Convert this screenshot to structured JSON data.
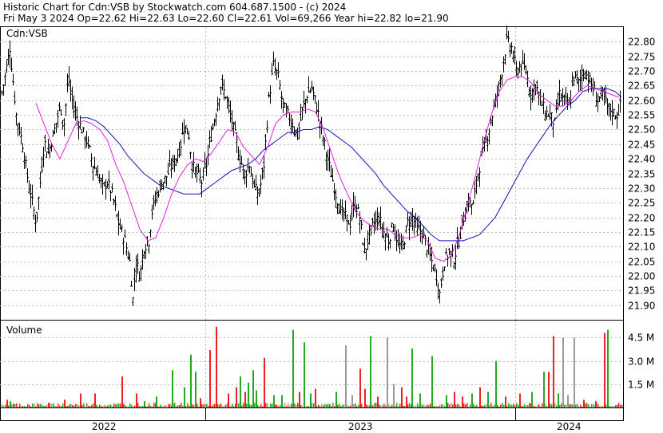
{
  "header": {
    "line1": "Historic Chart for Cdn:VSB by Stockwatch.com 604.687.1500 - (c) 2024",
    "line2": "Fri May  3 2024   Op=22.62   Hi=22.63   Lo=22.60   Cl=22.61   Vol=69,266   Year hi=22.82   lo=21.90"
  },
  "chart_data": [
    {
      "type": "ohlc",
      "title": "Cdn:VSB",
      "symbol_label": "Cdn:VSB",
      "ylim": [
        21.85,
        22.85
      ],
      "y_ticks": [
        "22.80",
        "22.75",
        "22.70",
        "22.65",
        "22.60",
        "22.55",
        "22.50",
        "22.45",
        "22.40",
        "22.35",
        "22.30",
        "22.25",
        "22.20",
        "22.15",
        "22.10",
        "22.05",
        "22.00",
        "21.95",
        "21.90"
      ],
      "grid": true,
      "colors": {
        "ohlc": "#000000",
        "ma_short": "#e020e0",
        "ma_long": "#1010c0",
        "grid": "#bbbbbb"
      },
      "anchor_closes": [
        [
          0,
          22.6
        ],
        [
          6,
          22.68
        ],
        [
          12,
          22.78
        ],
        [
          20,
          22.55
        ],
        [
          28,
          22.45
        ],
        [
          35,
          22.32
        ],
        [
          45,
          22.18
        ],
        [
          50,
          22.32
        ],
        [
          55,
          22.46
        ],
        [
          60,
          22.42
        ],
        [
          68,
          22.5
        ],
        [
          75,
          22.58
        ],
        [
          80,
          22.52
        ],
        [
          85,
          22.68
        ],
        [
          90,
          22.6
        ],
        [
          95,
          22.55
        ],
        [
          102,
          22.5
        ],
        [
          110,
          22.45
        ],
        [
          116,
          22.38
        ],
        [
          122,
          22.35
        ],
        [
          128,
          22.3
        ],
        [
          134,
          22.32
        ],
        [
          140,
          22.28
        ],
        [
          148,
          22.18
        ],
        [
          156,
          22.12
        ],
        [
          162,
          22.05
        ],
        [
          166,
          21.92
        ],
        [
          170,
          22.05
        ],
        [
          175,
          22.0
        ],
        [
          180,
          22.1
        ],
        [
          186,
          22.12
        ],
        [
          190,
          22.22
        ],
        [
          196,
          22.28
        ],
        [
          203,
          22.32
        ],
        [
          208,
          22.34
        ],
        [
          215,
          22.38
        ],
        [
          220,
          22.4
        ],
        [
          226,
          22.45
        ],
        [
          230,
          22.52
        ],
        [
          236,
          22.48
        ],
        [
          240,
          22.38
        ],
        [
          246,
          22.35
        ],
        [
          252,
          22.32
        ],
        [
          258,
          22.38
        ],
        [
          264,
          22.48
        ],
        [
          270,
          22.56
        ],
        [
          276,
          22.65
        ],
        [
          282,
          22.62
        ],
        [
          288,
          22.55
        ],
        [
          294,
          22.48
        ],
        [
          300,
          22.4
        ],
        [
          306,
          22.35
        ],
        [
          312,
          22.38
        ],
        [
          318,
          22.3
        ],
        [
          324,
          22.28
        ],
        [
          330,
          22.38
        ],
        [
          336,
          22.6
        ],
        [
          342,
          22.72
        ],
        [
          348,
          22.68
        ],
        [
          354,
          22.58
        ],
        [
          360,
          22.55
        ],
        [
          366,
          22.52
        ],
        [
          372,
          22.48
        ],
        [
          378,
          22.56
        ],
        [
          384,
          22.62
        ],
        [
          390,
          22.64
        ],
        [
          396,
          22.58
        ],
        [
          402,
          22.5
        ],
        [
          408,
          22.42
        ],
        [
          414,
          22.35
        ],
        [
          420,
          22.28
        ],
        [
          426,
          22.22
        ],
        [
          432,
          22.2
        ],
        [
          438,
          22.18
        ],
        [
          444,
          22.25
        ],
        [
          450,
          22.2
        ],
        [
          456,
          22.08
        ],
        [
          462,
          22.14
        ],
        [
          468,
          22.18
        ],
        [
          474,
          22.2
        ],
        [
          480,
          22.15
        ],
        [
          486,
          22.12
        ],
        [
          492,
          22.18
        ],
        [
          498,
          22.1
        ],
        [
          504,
          22.1
        ],
        [
          510,
          22.18
        ],
        [
          516,
          22.2
        ],
        [
          522,
          22.16
        ],
        [
          528,
          22.15
        ],
        [
          534,
          22.1
        ],
        [
          540,
          22.05
        ],
        [
          546,
          22.0
        ],
        [
          550,
          21.94
        ],
        [
          556,
          22.05
        ],
        [
          562,
          22.08
        ],
        [
          568,
          22.06
        ],
        [
          574,
          22.12
        ],
        [
          580,
          22.2
        ],
        [
          586,
          22.25
        ],
        [
          592,
          22.24
        ],
        [
          598,
          22.35
        ],
        [
          604,
          22.42
        ],
        [
          610,
          22.48
        ],
        [
          616,
          22.55
        ],
        [
          622,
          22.62
        ],
        [
          628,
          22.7
        ],
        [
          634,
          22.8
        ],
        [
          640,
          22.78
        ],
        [
          646,
          22.7
        ],
        [
          652,
          22.72
        ],
        [
          658,
          22.7
        ],
        [
          664,
          22.62
        ],
        [
          670,
          22.66
        ],
        [
          676,
          22.6
        ],
        [
          682,
          22.56
        ],
        [
          688,
          22.55
        ],
        [
          694,
          22.52
        ],
        [
          700,
          22.62
        ],
        [
          706,
          22.6
        ],
        [
          712,
          22.58
        ],
        [
          718,
          22.68
        ],
        [
          724,
          22.66
        ],
        [
          730,
          22.7
        ],
        [
          736,
          22.68
        ],
        [
          742,
          22.64
        ],
        [
          748,
          22.6
        ],
        [
          754,
          22.62
        ],
        [
          760,
          22.58
        ],
        [
          766,
          22.56
        ],
        [
          772,
          22.55
        ],
        [
          776,
          22.58
        ]
      ],
      "ma_short_anchors": [
        [
          45,
          22.59
        ],
        [
          55,
          22.52
        ],
        [
          65,
          22.45
        ],
        [
          75,
          22.4
        ],
        [
          85,
          22.46
        ],
        [
          95,
          22.52
        ],
        [
          105,
          22.53
        ],
        [
          115,
          22.52
        ],
        [
          125,
          22.5
        ],
        [
          135,
          22.46
        ],
        [
          145,
          22.38
        ],
        [
          155,
          22.32
        ],
        [
          165,
          22.24
        ],
        [
          175,
          22.16
        ],
        [
          185,
          22.12
        ],
        [
          195,
          22.13
        ],
        [
          205,
          22.2
        ],
        [
          215,
          22.28
        ],
        [
          225,
          22.34
        ],
        [
          235,
          22.38
        ],
        [
          245,
          22.4
        ],
        [
          255,
          22.39
        ],
        [
          265,
          22.42
        ],
        [
          275,
          22.46
        ],
        [
          285,
          22.5
        ],
        [
          295,
          22.49
        ],
        [
          305,
          22.44
        ],
        [
          315,
          22.41
        ],
        [
          325,
          22.38
        ],
        [
          335,
          22.44
        ],
        [
          345,
          22.52
        ],
        [
          355,
          22.55
        ],
        [
          365,
          22.56
        ],
        [
          375,
          22.56
        ],
        [
          385,
          22.57
        ],
        [
          395,
          22.56
        ],
        [
          405,
          22.5
        ],
        [
          415,
          22.42
        ],
        [
          425,
          22.34
        ],
        [
          435,
          22.28
        ],
        [
          445,
          22.22
        ],
        [
          455,
          22.19
        ],
        [
          465,
          22.17
        ],
        [
          475,
          22.16
        ],
        [
          485,
          22.16
        ],
        [
          495,
          22.14
        ],
        [
          505,
          22.13
        ],
        [
          515,
          22.13
        ],
        [
          525,
          22.14
        ],
        [
          535,
          22.12
        ],
        [
          545,
          22.06
        ],
        [
          555,
          22.05
        ],
        [
          565,
          22.07
        ],
        [
          575,
          22.14
        ],
        [
          585,
          22.24
        ],
        [
          595,
          22.34
        ],
        [
          605,
          22.45
        ],
        [
          615,
          22.55
        ],
        [
          625,
          22.63
        ],
        [
          635,
          22.67
        ],
        [
          645,
          22.68
        ],
        [
          655,
          22.68
        ],
        [
          665,
          22.66
        ],
        [
          675,
          22.62
        ],
        [
          685,
          22.6
        ],
        [
          695,
          22.58
        ],
        [
          705,
          22.58
        ],
        [
          715,
          22.6
        ],
        [
          725,
          22.63
        ],
        [
          735,
          22.65
        ],
        [
          745,
          22.64
        ],
        [
          755,
          22.63
        ],
        [
          765,
          22.62
        ],
        [
          775,
          22.61
        ]
      ],
      "ma_long_anchors": [
        [
          100,
          22.54
        ],
        [
          110,
          22.54
        ],
        [
          120,
          22.53
        ],
        [
          130,
          22.51
        ],
        [
          140,
          22.48
        ],
        [
          150,
          22.45
        ],
        [
          160,
          22.41
        ],
        [
          170,
          22.38
        ],
        [
          180,
          22.35
        ],
        [
          190,
          22.33
        ],
        [
          200,
          22.31
        ],
        [
          210,
          22.3
        ],
        [
          220,
          22.29
        ],
        [
          230,
          22.28
        ],
        [
          240,
          22.28
        ],
        [
          250,
          22.28
        ],
        [
          260,
          22.3
        ],
        [
          270,
          22.32
        ],
        [
          280,
          22.34
        ],
        [
          290,
          22.36
        ],
        [
          300,
          22.37
        ],
        [
          310,
          22.38
        ],
        [
          320,
          22.4
        ],
        [
          330,
          22.43
        ],
        [
          340,
          22.45
        ],
        [
          350,
          22.47
        ],
        [
          360,
          22.49
        ],
        [
          370,
          22.49
        ],
        [
          380,
          22.5
        ],
        [
          390,
          22.5
        ],
        [
          400,
          22.51
        ],
        [
          410,
          22.5
        ],
        [
          420,
          22.48
        ],
        [
          430,
          22.46
        ],
        [
          440,
          22.44
        ],
        [
          450,
          22.41
        ],
        [
          460,
          22.38
        ],
        [
          470,
          22.35
        ],
        [
          480,
          22.31
        ],
        [
          490,
          22.28
        ],
        [
          500,
          22.25
        ],
        [
          510,
          22.22
        ],
        [
          520,
          22.2
        ],
        [
          530,
          22.17
        ],
        [
          540,
          22.14
        ],
        [
          550,
          22.12
        ],
        [
          560,
          22.12
        ],
        [
          570,
          22.12
        ],
        [
          580,
          22.12
        ],
        [
          590,
          22.13
        ],
        [
          600,
          22.14
        ],
        [
          610,
          22.17
        ],
        [
          620,
          22.2
        ],
        [
          630,
          22.25
        ],
        [
          640,
          22.3
        ],
        [
          650,
          22.35
        ],
        [
          660,
          22.4
        ],
        [
          670,
          22.44
        ],
        [
          680,
          22.48
        ],
        [
          690,
          22.52
        ],
        [
          700,
          22.55
        ],
        [
          710,
          22.58
        ],
        [
          720,
          22.6
        ],
        [
          730,
          22.63
        ],
        [
          740,
          22.64
        ],
        [
          750,
          22.64
        ],
        [
          760,
          22.64
        ],
        [
          770,
          22.63
        ],
        [
          778,
          22.61
        ]
      ]
    },
    {
      "type": "bar",
      "title": "Volume",
      "y_ticks": [
        "4.5 M",
        "3.0 M",
        "1.5 M"
      ],
      "ylim_millions": [
        0,
        5.6
      ],
      "colors": {
        "up": "#22aa22",
        "down": "#ee2222",
        "flat": "#999999"
      },
      "spikes": [
        [
          8,
          0.5,
          "d"
        ],
        [
          12,
          0.4,
          "g"
        ],
        [
          60,
          0.3,
          "d"
        ],
        [
          80,
          0.5,
          "d"
        ],
        [
          100,
          0.9,
          "d"
        ],
        [
          118,
          0.9,
          "d"
        ],
        [
          152,
          2.0,
          "d"
        ],
        [
          170,
          0.9,
          "d"
        ],
        [
          180,
          0.4,
          "g"
        ],
        [
          195,
          0.7,
          "g"
        ],
        [
          215,
          2.4,
          "g"
        ],
        [
          230,
          1.3,
          "g"
        ],
        [
          238,
          3.4,
          "g"
        ],
        [
          244,
          2.3,
          "g"
        ],
        [
          250,
          0.6,
          "d"
        ],
        [
          262,
          3.7,
          "d"
        ],
        [
          270,
          5.2,
          "d"
        ],
        [
          285,
          0.9,
          "d"
        ],
        [
          295,
          1.3,
          "d"
        ],
        [
          300,
          2.0,
          "g"
        ],
        [
          306,
          1.0,
          "d"
        ],
        [
          310,
          1.6,
          "g"
        ],
        [
          316,
          2.4,
          "g"
        ],
        [
          320,
          1.1,
          "g"
        ],
        [
          330,
          3.2,
          "d"
        ],
        [
          342,
          0.8,
          "g"
        ],
        [
          352,
          0.8,
          "g"
        ],
        [
          366,
          5.0,
          "g"
        ],
        [
          374,
          1.0,
          "d"
        ],
        [
          380,
          4.2,
          "g"
        ],
        [
          388,
          0.9,
          "g"
        ],
        [
          394,
          1.2,
          "d"
        ],
        [
          420,
          1.0,
          "g"
        ],
        [
          432,
          4.0,
          "f"
        ],
        [
          440,
          0.8,
          "f"
        ],
        [
          450,
          2.5,
          "d"
        ],
        [
          456,
          1.2,
          "d"
        ],
        [
          463,
          4.6,
          "g"
        ],
        [
          472,
          0.7,
          "d"
        ],
        [
          484,
          4.5,
          "f"
        ],
        [
          492,
          1.5,
          "f"
        ],
        [
          502,
          1.3,
          "d"
        ],
        [
          508,
          0.7,
          "d"
        ],
        [
          515,
          3.8,
          "g"
        ],
        [
          525,
          0.9,
          "g"
        ],
        [
          540,
          3.3,
          "g"
        ],
        [
          558,
          0.8,
          "g"
        ],
        [
          568,
          1.0,
          "d"
        ],
        [
          578,
          0.7,
          "d"
        ],
        [
          590,
          0.9,
          "g"
        ],
        [
          600,
          1.3,
          "d"
        ],
        [
          610,
          1.0,
          "g"
        ],
        [
          620,
          3.0,
          "g"
        ],
        [
          632,
          0.7,
          "d"
        ],
        [
          650,
          0.9,
          "d"
        ],
        [
          665,
          1.0,
          "g"
        ],
        [
          680,
          2.3,
          "g"
        ],
        [
          686,
          2.3,
          "d"
        ],
        [
          692,
          4.6,
          "d"
        ],
        [
          698,
          0.9,
          "g"
        ],
        [
          704,
          4.5,
          "f"
        ],
        [
          710,
          0.8,
          "f"
        ],
        [
          718,
          4.5,
          "f"
        ],
        [
          730,
          0.5,
          "d"
        ],
        [
          745,
          0.4,
          "d"
        ],
        [
          756,
          4.8,
          "d"
        ],
        [
          760,
          5.0,
          "g"
        ]
      ]
    }
  ],
  "volume_label": "Volume",
  "time_axis": {
    "labels": [
      "2022",
      "2023",
      "2024"
    ]
  }
}
